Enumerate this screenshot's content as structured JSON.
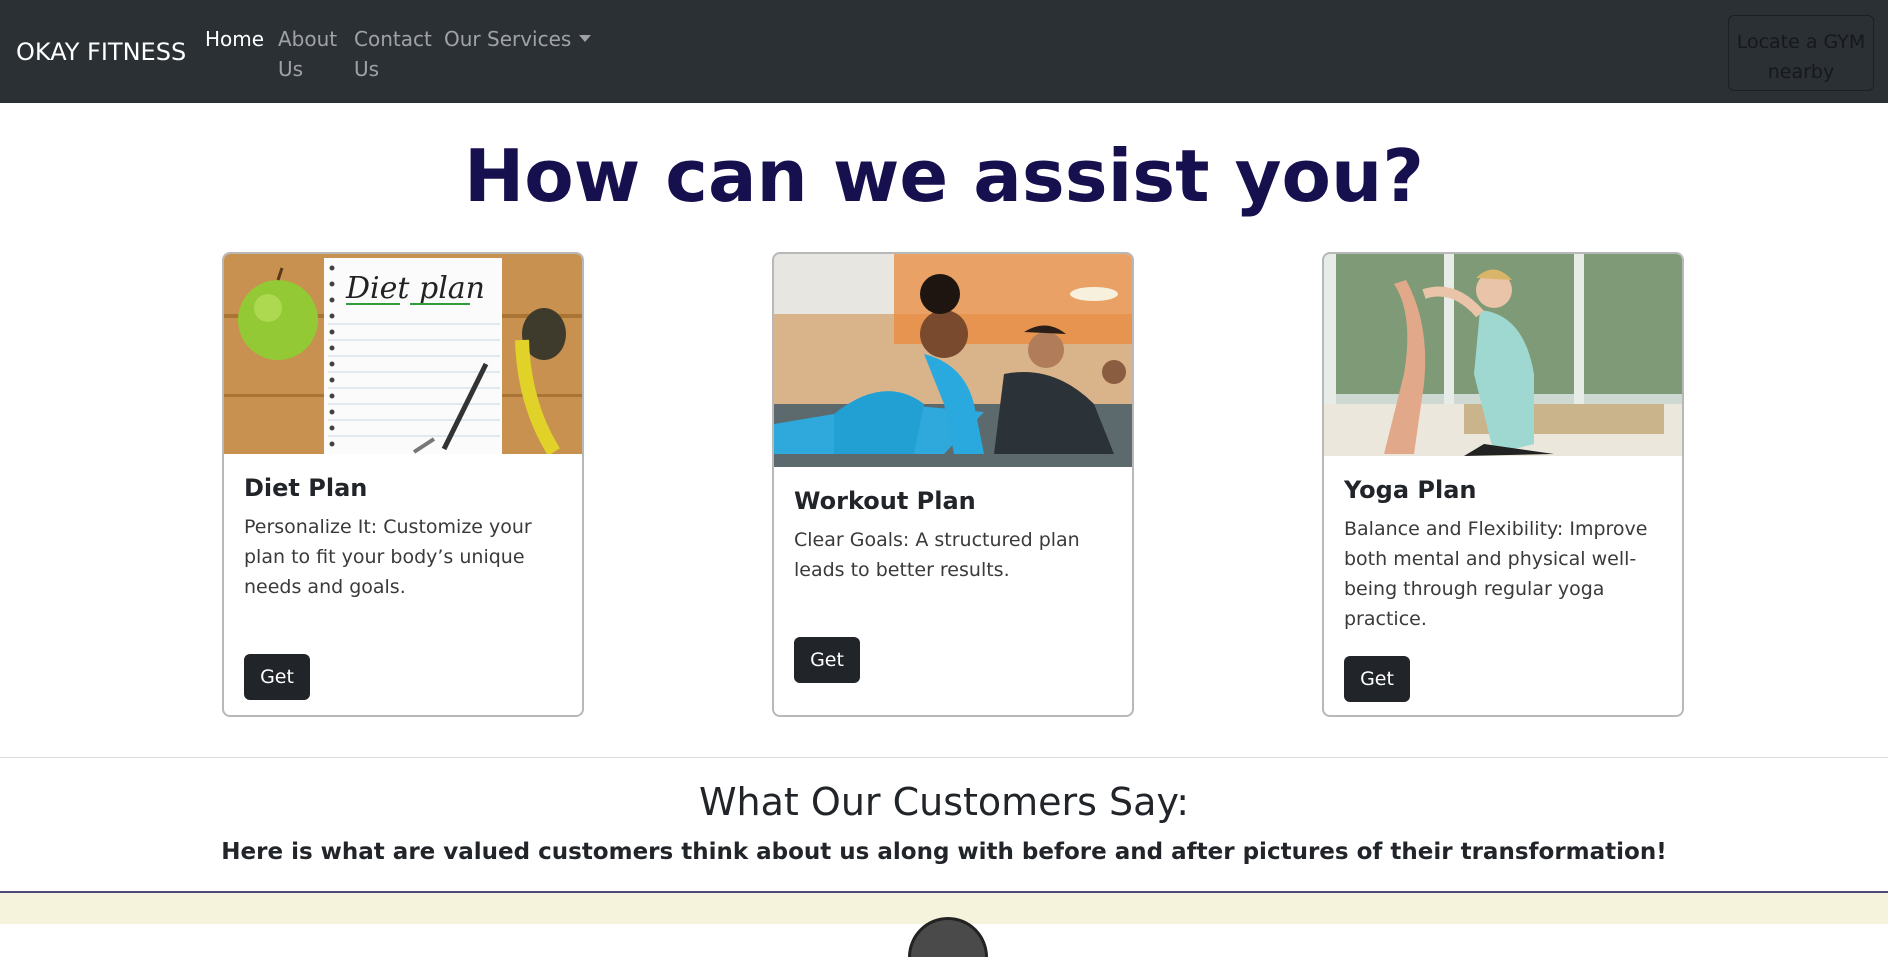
{
  "navbar": {
    "brand": "OKAY FITNESS",
    "links": [
      {
        "label": "Home"
      },
      {
        "label": "About Us"
      },
      {
        "label": "Contact Us"
      },
      {
        "label": "Our Services"
      }
    ],
    "locate_button": "Locate a GYM nearby"
  },
  "hero": {
    "title": "How can we assist you?"
  },
  "cards": [
    {
      "image_label": "Diet plan",
      "title": "Diet Plan",
      "text": "Personalize It: Customize your plan to fit your body’s unique needs and goals.",
      "button": "Get"
    },
    {
      "title": "Workout Plan",
      "text": "Clear Goals: A structured plan leads to better results.",
      "button": "Get"
    },
    {
      "title": "Yoga Plan",
      "text": "Balance and Flexibility: Improve both mental and physical well-being through regular yoga practice.",
      "button": "Get"
    }
  ],
  "testimonials": {
    "title": "What Our Customers Say:",
    "subtitle": "Here is what are valued customers think about us along with before and after pictures of their transformation!"
  },
  "colors": {
    "navbar_bg": "#2b3035",
    "hero_title": "#16104f",
    "button_bg": "#212529",
    "strip_bg": "#f5f3dc"
  }
}
